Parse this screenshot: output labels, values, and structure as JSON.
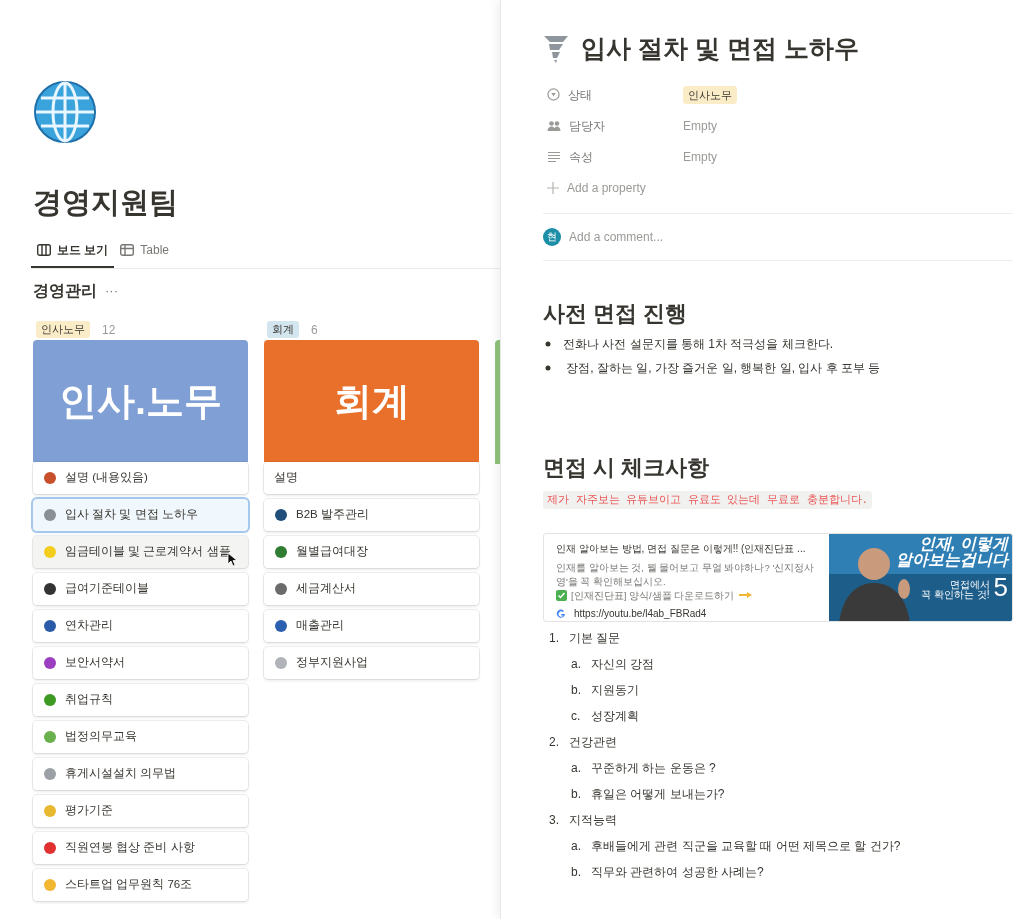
{
  "workspace": {
    "title": "경영지원팀"
  },
  "views": [
    {
      "label": "보드 보기",
      "kind": "board",
      "selected": true
    },
    {
      "label": "Table",
      "kind": "table",
      "selected": false
    }
  ],
  "group": {
    "title": "경영관리",
    "more": "···"
  },
  "columns": [
    {
      "tag": {
        "label": "인사노무",
        "color": "#fbecc8"
      },
      "count": "12",
      "cover_text": "인사.노무",
      "color": "#809fd4",
      "cards": [
        {
          "title": "설명 (내용있음)",
          "color": "#c8502a",
          "selected": false,
          "hovered": false
        },
        {
          "title": "입사 절차 및 면접 노하우",
          "color": "#8a8f96",
          "selected": true,
          "hovered": false
        },
        {
          "title": "임금테이블 및 근로계약서 샘플",
          "color": "#f3cd1c",
          "selected": false,
          "hovered": true
        },
        {
          "title": "급여기준테이블",
          "color": "#333333",
          "selected": false,
          "hovered": false
        },
        {
          "title": "연차관리",
          "color": "#2a5aa8",
          "selected": false,
          "hovered": false
        },
        {
          "title": "보안서약서",
          "color": "#9b3fc0",
          "selected": false,
          "hovered": false
        },
        {
          "title": "취업규칙",
          "color": "#3d9a22",
          "selected": false,
          "hovered": false
        },
        {
          "title": "법정의무교육",
          "color": "#6ab04c",
          "selected": false,
          "hovered": false
        },
        {
          "title": "휴게시설설치 의무법",
          "color": "#9aa0a6",
          "selected": false,
          "hovered": false
        },
        {
          "title": "평가기준",
          "color": "#e8b830",
          "selected": false,
          "hovered": false
        },
        {
          "title": "직원연봉 협상 준비 사항",
          "color": "#e03030",
          "selected": false,
          "hovered": false
        },
        {
          "title": "스타트업 업무원칙 76조",
          "color": "#f2b632",
          "selected": false,
          "hovered": false
        }
      ]
    },
    {
      "tag": {
        "label": "회계",
        "color": "#d3e5ef"
      },
      "count": "6",
      "cover_text": "회계",
      "color": "#e9702b",
      "cards": [
        {
          "title": "설명",
          "selected": false,
          "hovered": false
        },
        {
          "title": "B2B 발주관리",
          "color": "#1f4f7a",
          "selected": false,
          "hovered": false
        },
        {
          "title": "월별급여대장",
          "color": "#2f7d32",
          "selected": false,
          "hovered": false
        },
        {
          "title": "세금계산서",
          "color": "#6b6b6b",
          "selected": false,
          "hovered": false
        },
        {
          "title": "매출관리",
          "color": "#2c5fb0",
          "selected": false,
          "hovered": false
        },
        {
          "title": "정부지원사업",
          "color": "#b0b4b8",
          "selected": false,
          "hovered": false
        }
      ]
    }
  ],
  "page": {
    "title": "입사 절차 및 면접 노하우",
    "properties": [
      {
        "kind": "status",
        "label": "상태",
        "tag": {
          "label": "인사노무",
          "color": "#fbecc8"
        }
      },
      {
        "kind": "person",
        "label": "담당자",
        "value": "Empty"
      },
      {
        "kind": "text",
        "label": "속성",
        "value": "Empty"
      }
    ],
    "add_property": "Add a property",
    "comment": {
      "avatar": "현",
      "placeholder": "Add a comment..."
    },
    "sections": [
      {
        "heading": "사전 면접 진행",
        "bullets": [
          "전화나 사전 설문지를 통해 1차 적극성을 체크한다.",
          " 장점, 잘하는 일, 가장 즐거운 일, 행복한 일, 입사 후 포부 등"
        ]
      },
      {
        "heading": "면접 시 체크사항",
        "code": "제가 자주보는 유튜브이고 유료도 있는데 무료로 충분합니다.",
        "bookmark": {
          "title": "인재 알아보는 방법, 면접 질문은 이렇게!! (인재진단표 ...",
          "description_1": "인재를 알아보는 것, 뭘 물어보고 무얼 봐야하나? '신지정사영'을 꼭 확인해보십시오.",
          "description_2": "[인재진단표] 양식/샘플 다운로드하기",
          "url": "https://youtu.be/l4ab_FBRad4",
          "thumbnail_line_1": "인재, 이렇게",
          "thumbnail_line_2": "알아보는겁니다",
          "thumbnail_line_3": "면접에서",
          "thumbnail_line_4": "꼭 확인하는 것!",
          "thumbnail_number": "5"
        },
        "list": [
          {
            "marker": "1.",
            "text": "기본 질문",
            "children": [
              {
                "marker": "a.",
                "text": "자신의 강점"
              },
              {
                "marker": "b.",
                "text": "지원동기"
              },
              {
                "marker": "c.",
                "text": "성장계획"
              }
            ]
          },
          {
            "marker": "2.",
            "text": "건강관련",
            "children": [
              {
                "marker": "a.",
                "text": "꾸준하게 하는 운동은 ?"
              },
              {
                "marker": "b.",
                "text": "휴일은 어떻게 보내는가?"
              }
            ]
          },
          {
            "marker": "3.",
            "text": "지적능력",
            "children": [
              {
                "marker": "a.",
                "text": "후배들에게 관련 직군을 교육할 때 어떤 제목으로 할 건가?"
              },
              {
                "marker": "b.",
                "text": "직무와 관련하여 성공한 사례는?"
              }
            ]
          }
        ]
      }
    ]
  }
}
